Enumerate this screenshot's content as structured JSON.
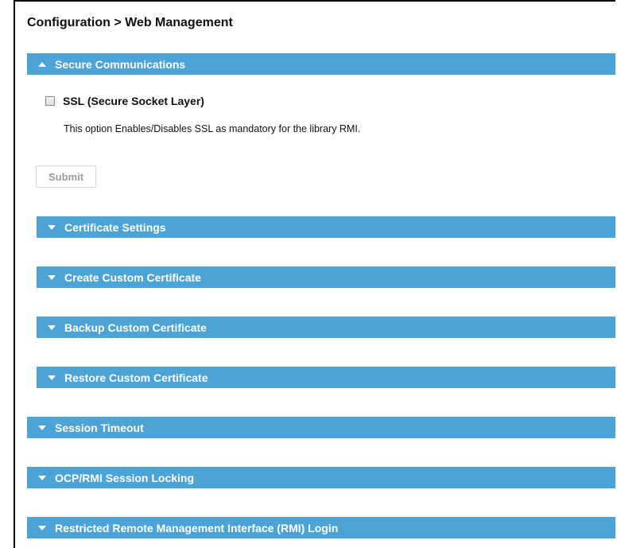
{
  "header": {
    "title": "Configuration > Web Management"
  },
  "secure_communications": {
    "label": "Secure Communications",
    "expanded": true,
    "ssl_checkbox": {
      "label": "SSL (Secure Socket Layer)",
      "checked": false
    },
    "description": "This option Enables/Disables SSL as mandatory for the library RMI.",
    "submit_label": "Submit",
    "submit_enabled": false,
    "subsections": [
      {
        "label": "Certificate Settings",
        "expanded": false
      },
      {
        "label": "Create Custom Certificate",
        "expanded": false
      },
      {
        "label": "Backup Custom Certificate",
        "expanded": false
      },
      {
        "label": "Restore Custom Certificate",
        "expanded": false
      }
    ]
  },
  "sections": [
    {
      "label": "Session Timeout",
      "expanded": false
    },
    {
      "label": "OCP/RMI Session Locking",
      "expanded": false
    },
    {
      "label": "Restricted Remote Management Interface (RMI) Login",
      "expanded": false
    }
  ],
  "colors": {
    "section_bar": "#4ba3d6",
    "section_text": "#ffffff",
    "disabled_text": "#9a9a9a"
  }
}
